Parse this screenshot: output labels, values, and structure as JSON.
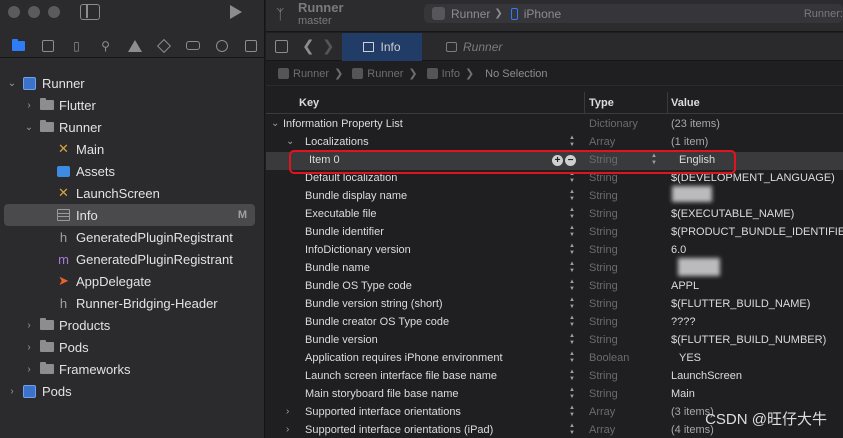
{
  "window": {
    "project_title": "Runner",
    "branch": "master",
    "scheme_app": "Runner",
    "scheme_device": "iPhone",
    "status_text": "Runner:"
  },
  "navigator": {
    "tree": [
      {
        "label": "Runner",
        "indent": 0,
        "icon": "project-icon",
        "disclosure": "open"
      },
      {
        "label": "Flutter",
        "indent": 1,
        "icon": "folder-icon",
        "disclosure": "closed"
      },
      {
        "label": "Runner",
        "indent": 1,
        "icon": "folder-icon",
        "disclosure": "open"
      },
      {
        "label": "Main",
        "indent": 2,
        "icon": "xib-icon",
        "disclosure": ""
      },
      {
        "label": "Assets",
        "indent": 2,
        "icon": "assets-icon",
        "disclosure": ""
      },
      {
        "label": "LaunchScreen",
        "indent": 2,
        "icon": "xib-icon",
        "disclosure": ""
      },
      {
        "label": "Info",
        "indent": 2,
        "icon": "plist-icon",
        "disclosure": "",
        "selected": true,
        "status": "M"
      },
      {
        "label": "GeneratedPluginRegistrant",
        "indent": 2,
        "icon": "header-icon",
        "disclosure": ""
      },
      {
        "label": "GeneratedPluginRegistrant",
        "indent": 2,
        "icon": "objc-icon",
        "disclosure": ""
      },
      {
        "label": "AppDelegate",
        "indent": 2,
        "icon": "swift-icon",
        "disclosure": ""
      },
      {
        "label": "Runner-Bridging-Header",
        "indent": 2,
        "icon": "header-icon",
        "disclosure": ""
      },
      {
        "label": "Products",
        "indent": 1,
        "icon": "folder-icon",
        "disclosure": "closed"
      },
      {
        "label": "Pods",
        "indent": 1,
        "icon": "folder-icon",
        "disclosure": "closed"
      },
      {
        "label": "Frameworks",
        "indent": 1,
        "icon": "folder-icon",
        "disclosure": "closed"
      },
      {
        "label": "Pods",
        "indent": 0,
        "icon": "project-icon",
        "disclosure": "closed"
      }
    ]
  },
  "tabs": {
    "info": "Info",
    "runner": "Runner"
  },
  "jumpbar": {
    "crumb1": "Runner",
    "crumb2": "Runner",
    "crumb3": "Info",
    "no_selection": "No Selection"
  },
  "table": {
    "headers": {
      "key": "Key",
      "type": "Type",
      "value": "Value"
    },
    "rows": [
      {
        "key": "Information Property List",
        "type": "Dictionary",
        "value": "(23 items)",
        "level": 0,
        "disc": "open",
        "dim": true
      },
      {
        "key": "Localizations",
        "type": "Array",
        "value": "(1 item)",
        "level": 1,
        "disc": "open",
        "dim": true,
        "stepper": true
      },
      {
        "key": "Item 0",
        "type": "String",
        "value": "English",
        "level": 2,
        "disc": "",
        "highlight": true,
        "plusminus": true,
        "stepper2": true
      },
      {
        "key": "Default localization",
        "type": "String",
        "value": "$(DEVELOPMENT_LANGUAGE)",
        "level": 1,
        "disc": "",
        "stepper": true
      },
      {
        "key": "Bundle display name",
        "type": "String",
        "value": "",
        "level": 1,
        "disc": "",
        "stepper": true
      },
      {
        "key": "Executable file",
        "type": "String",
        "value": "$(EXECUTABLE_NAME)",
        "level": 1,
        "disc": "",
        "stepper": true
      },
      {
        "key": "Bundle identifier",
        "type": "String",
        "value": "$(PRODUCT_BUNDLE_IDENTIFIER)",
        "level": 1,
        "disc": "",
        "stepper": true
      },
      {
        "key": "InfoDictionary version",
        "type": "String",
        "value": "6.0",
        "level": 1,
        "disc": "",
        "stepper": true
      },
      {
        "key": "Bundle name",
        "type": "String",
        "value": "",
        "level": 1,
        "disc": "",
        "stepper": true
      },
      {
        "key": "Bundle OS Type code",
        "type": "String",
        "value": "APPL",
        "level": 1,
        "disc": "",
        "stepper": true
      },
      {
        "key": "Bundle version string (short)",
        "type": "String",
        "value": "$(FLUTTER_BUILD_NAME)",
        "level": 1,
        "disc": "",
        "stepper": true
      },
      {
        "key": "Bundle creator OS Type code",
        "type": "String",
        "value": "????",
        "level": 1,
        "disc": "",
        "stepper": true
      },
      {
        "key": "Bundle version",
        "type": "String",
        "value": "$(FLUTTER_BUILD_NUMBER)",
        "level": 1,
        "disc": "",
        "stepper": true
      },
      {
        "key": "Application requires iPhone environment",
        "type": "Boolean",
        "value": "YES",
        "level": 1,
        "disc": "",
        "stepper": true
      },
      {
        "key": "Launch screen interface file base name",
        "type": "String",
        "value": "LaunchScreen",
        "level": 1,
        "disc": "",
        "stepper": true
      },
      {
        "key": "Main storyboard file base name",
        "type": "String",
        "value": "Main",
        "level": 1,
        "disc": "",
        "stepper": true
      },
      {
        "key": "Supported interface orientations",
        "type": "Array",
        "value": "(3 items)",
        "level": 1,
        "disc": "closed",
        "dim": true,
        "stepper": true
      },
      {
        "key": "Supported interface orientations (iPad)",
        "type": "Array",
        "value": "(4 items)",
        "level": 1,
        "disc": "closed",
        "dim": true,
        "stepper": true
      }
    ]
  },
  "watermark": "CSDN @旺仔大牛"
}
